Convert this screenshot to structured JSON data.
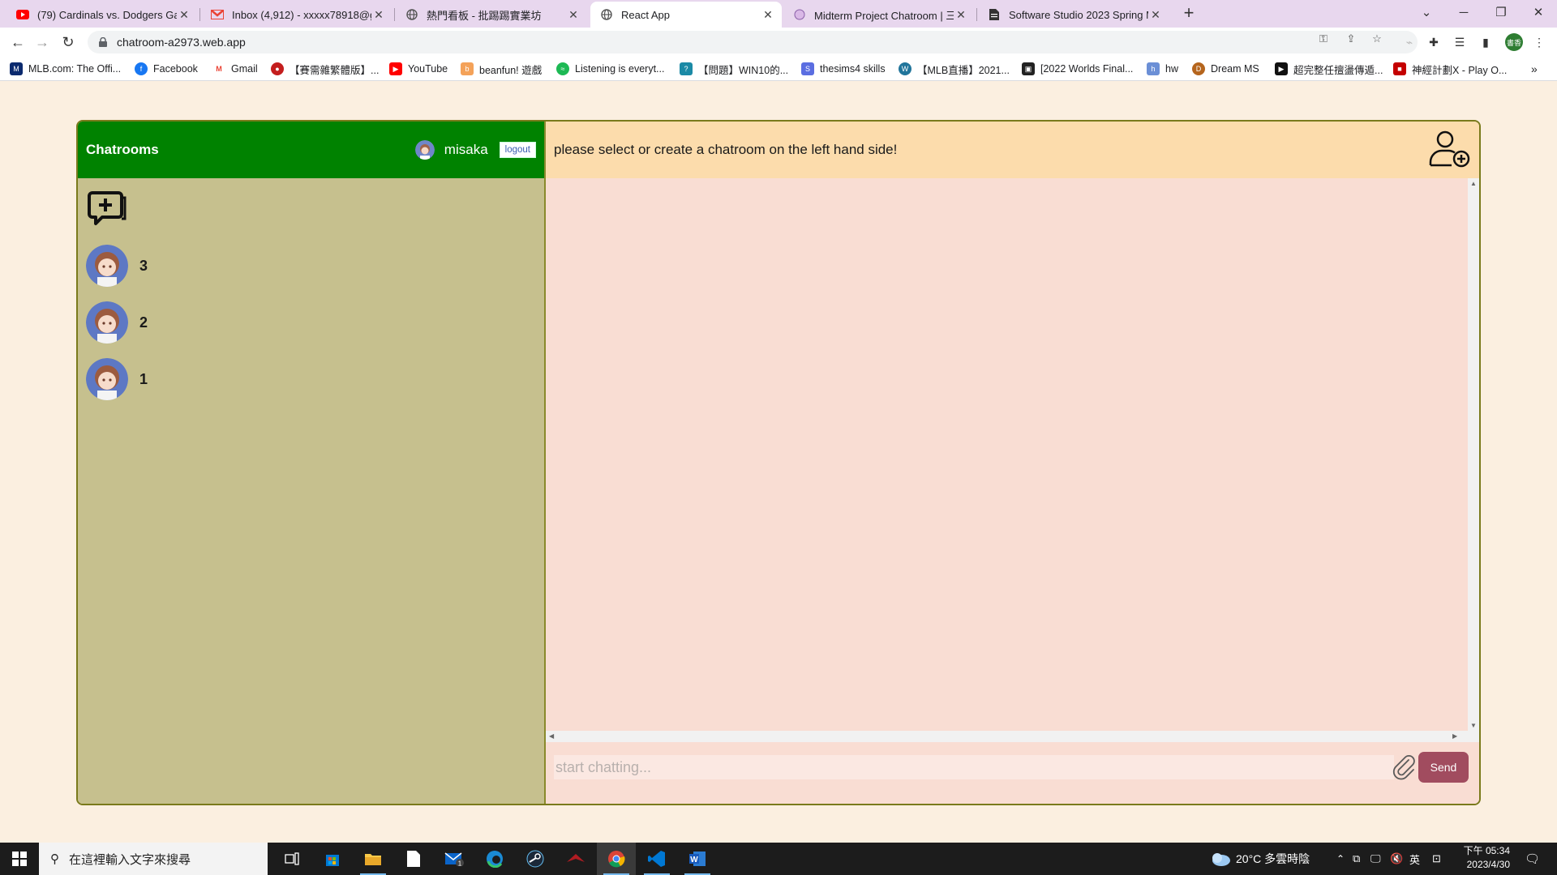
{
  "browser": {
    "tabs": [
      {
        "label": "(79) Cardinals vs. Dodgers Gam",
        "icon": "youtube-icon"
      },
      {
        "label": "Inbox (4,912) - xxxxx78918@gm",
        "icon": "gmail-icon"
      },
      {
        "label": "熱門看板 - 批踢踢實業坊",
        "icon": "globe-icon"
      },
      {
        "label": "React App",
        "icon": "globe-icon"
      },
      {
        "label": "Midterm Project Chatroom | 三",
        "icon": "hackmd-icon"
      },
      {
        "label": "Software Studio 2023 Spring M",
        "icon": "doc-icon"
      }
    ],
    "url": "chatroom-a2973.web.app",
    "bookmarks": [
      {
        "label": "MLB.com: The Offi...",
        "color": "#0b2a6e"
      },
      {
        "label": "Facebook",
        "color": "#1877f2"
      },
      {
        "label": "Gmail",
        "color": "#ea4335"
      },
      {
        "label": "【賽需雜繁體版】...",
        "color": "#c41e1e"
      },
      {
        "label": "YouTube",
        "color": "#ff0000"
      },
      {
        "label": "beanfun! 遊戲",
        "color": "#f4a259"
      },
      {
        "label": "Listening is everyt...",
        "color": "#1db954"
      },
      {
        "label": "【問題】WIN10的...",
        "color": "#1b8aa6"
      },
      {
        "label": "thesims4 skills",
        "color": "#5b6ee1"
      },
      {
        "label": "【MLB直播】2021...",
        "color": "#21759b"
      },
      {
        "label": "[2022 Worlds Final...",
        "color": "#222222"
      },
      {
        "label": "hw",
        "color": "#6b8fd6"
      },
      {
        "label": "Dream MS",
        "color": "#b5651d"
      },
      {
        "label": "超完整任擅盪傳遁...",
        "color": "#111111"
      },
      {
        "label": "神經計劃X - Play O...",
        "color": "#c40000"
      }
    ],
    "profile_initials": "書香"
  },
  "app": {
    "sidebar_title": "Chatrooms",
    "username": "misaka",
    "logout_label": "logout",
    "rooms": [
      {
        "name": "3"
      },
      {
        "name": "2"
      },
      {
        "name": "1"
      }
    ],
    "main_prompt": "please select or create a chatroom on the left hand side!",
    "input_placeholder": "start chatting...",
    "send_label": "Send"
  },
  "taskbar": {
    "search_placeholder": "在這裡輸入文字來搜尋",
    "weather": "20°C 多雲時陰",
    "ime": "英",
    "time": "下午 05:34",
    "date": "2023/4/30",
    "mail_badge": "1"
  }
}
